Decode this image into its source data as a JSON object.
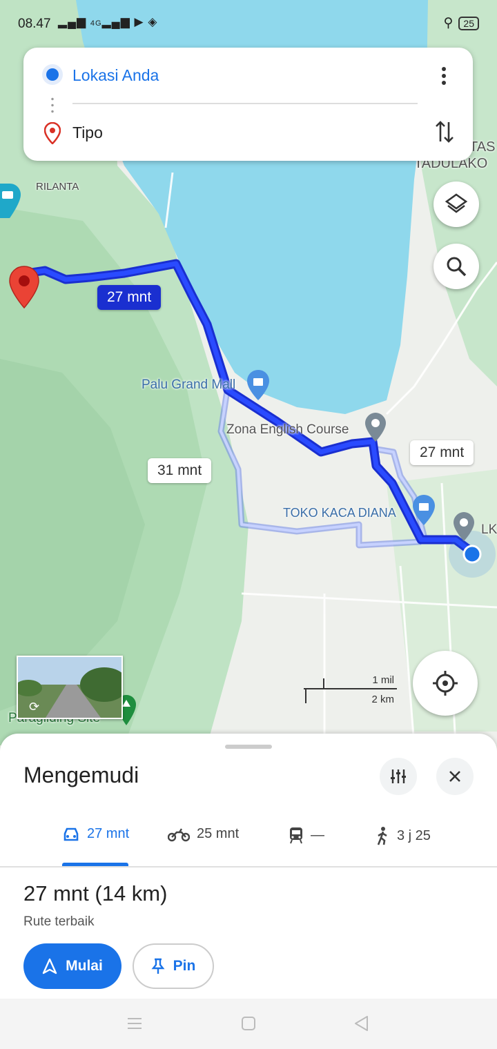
{
  "status_bar": {
    "time": "08.47",
    "signal": "…ˢᴴᴱ…",
    "network_label": "4G",
    "battery": "25"
  },
  "search": {
    "origin": "Lokasi Anda",
    "destination": "Tipo"
  },
  "map_labels": {
    "rilanta": "RILANTA",
    "tadulako_top": "TAS",
    "tadulako": "TADULAKO",
    "palu_grand_mall": "Palu Grand Mall",
    "zona_english": "Zona English Course",
    "toko_kaca": "TOKO KACA DIANA",
    "lk": "LK",
    "paragliding": "Paragliding Site"
  },
  "route_bubbles": {
    "primary": "27 mnt",
    "alt_1": "27 mnt",
    "alt_2": "31 mnt"
  },
  "scale": {
    "miles": "1 mil",
    "km": "2 km"
  },
  "sheet": {
    "title": "Mengemudi",
    "modes": [
      {
        "icon": "car-icon",
        "label": "27 mnt"
      },
      {
        "icon": "motorbike-icon",
        "label": "25 mnt"
      },
      {
        "icon": "transit-icon",
        "label": "—"
      },
      {
        "icon": "walk-icon",
        "label": "3 j 25"
      }
    ],
    "duration": "27 mnt (14 km)",
    "subtitle": "Rute terbaik",
    "start_label": "Mulai",
    "pin_label": "Pin"
  },
  "colors": {
    "accent": "#1a73e8",
    "route": "#1a3bff",
    "water": "#8fd8ec",
    "land": "#cfe9d2"
  }
}
